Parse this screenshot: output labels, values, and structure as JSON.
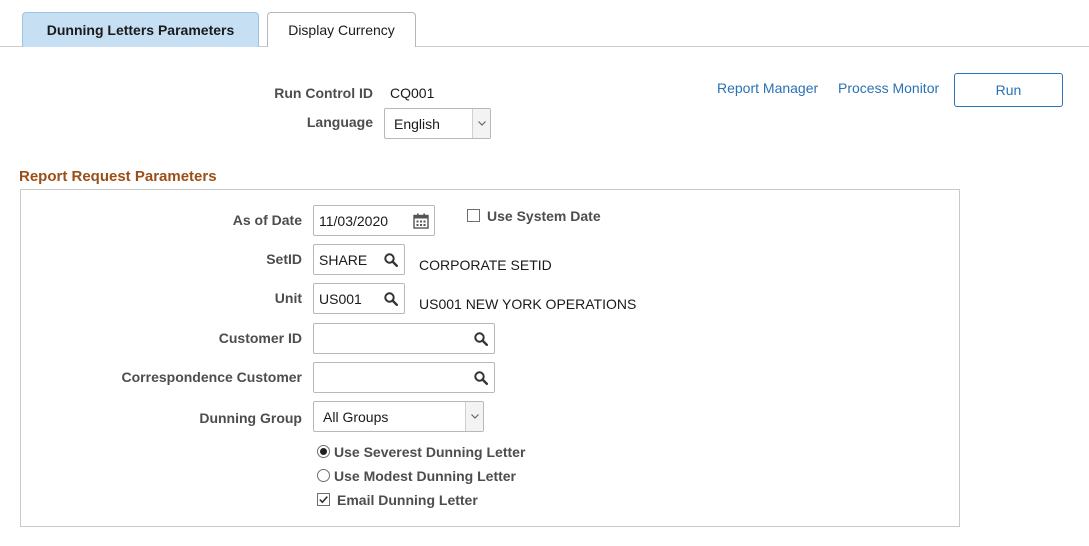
{
  "tabs": [
    {
      "label": "Dunning Letters Parameters",
      "active": true
    },
    {
      "label": "Display Currency",
      "active": false
    }
  ],
  "header": {
    "run_control_label": "Run Control ID",
    "run_control_value": "CQ001",
    "language_label": "Language",
    "language_value": "English",
    "report_manager_link": "Report Manager",
    "process_monitor_link": "Process Monitor",
    "run_button": "Run"
  },
  "section": {
    "title": "Report Request Parameters",
    "as_of_date_label": "As of Date",
    "as_of_date_value": "11/03/2020",
    "use_system_date_label": "Use System Date",
    "use_system_date_checked": false,
    "setid_label": "SetID",
    "setid_value": "SHARE",
    "setid_description": "CORPORATE SETID",
    "unit_label": "Unit",
    "unit_value": "US001",
    "unit_description": "US001 NEW YORK OPERATIONS",
    "customer_id_label": "Customer ID",
    "customer_id_value": "",
    "corr_customer_label": "Correspondence Customer",
    "corr_customer_value": "",
    "dunning_group_label": "Dunning Group",
    "dunning_group_value": "All Groups",
    "radio_severest_label": "Use Severest Dunning Letter",
    "radio_severest_selected": true,
    "radio_modest_label": "Use Modest Dunning Letter",
    "radio_modest_selected": false,
    "email_label": "Email Dunning Letter",
    "email_checked": true
  },
  "colors": {
    "link": "#2a72b5",
    "active_tab": "#c6dff3",
    "section_title": "#9b4f16"
  },
  "icons": {
    "search": "search-icon",
    "calendar": "calendar-icon",
    "dropdown": "chevron-down-icon"
  }
}
